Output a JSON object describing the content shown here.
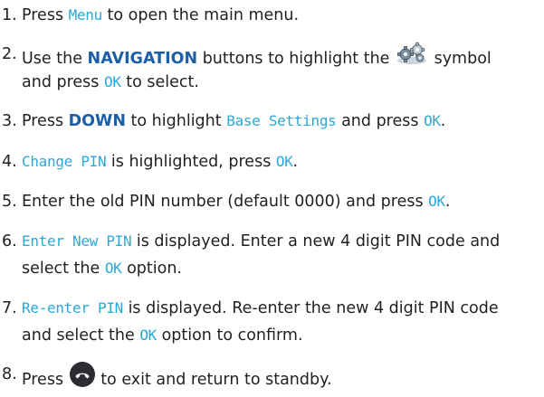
{
  "steps": [
    {
      "number": "1.",
      "lines": [
        [
          {
            "t": "Press "
          },
          {
            "t": "Menu",
            "s": "lcd"
          },
          {
            "t": " to open the main menu."
          }
        ]
      ]
    },
    {
      "number": "2.",
      "lines": [
        [
          {
            "t": "Use the "
          },
          {
            "t": "NAVIGATION",
            "s": "kw"
          },
          {
            "t": " buttons to highlight the "
          },
          {
            "icon": "settings-gear-icon"
          },
          {
            "t": " symbol"
          }
        ],
        [
          {
            "t": "and press "
          },
          {
            "t": "OK",
            "s": "lcd"
          },
          {
            "t": " to select."
          }
        ]
      ]
    },
    {
      "number": "3.",
      "lines": [
        [
          {
            "t": "Press "
          },
          {
            "t": "DOWN",
            "s": "kw"
          },
          {
            "t": " to highlight "
          },
          {
            "t": "Base Settings",
            "s": "lcd"
          },
          {
            "t": " and press "
          },
          {
            "t": "OK",
            "s": "lcd"
          },
          {
            "t": "."
          }
        ]
      ]
    },
    {
      "number": "4.",
      "lines": [
        [
          {
            "t": "Change PIN",
            "s": "lcd"
          },
          {
            "t": " is highlighted, press "
          },
          {
            "t": "OK",
            "s": "lcd"
          },
          {
            "t": "."
          }
        ]
      ]
    },
    {
      "number": "5.",
      "lines": [
        [
          {
            "t": "Enter the old PIN number (default 0000) and press "
          },
          {
            "t": "OK",
            "s": "lcd"
          },
          {
            "t": "."
          }
        ]
      ]
    },
    {
      "number": "6.",
      "lines": [
        [
          {
            "t": "Enter New PIN",
            "s": "lcd"
          },
          {
            "t": " is displayed. Enter a new 4 digit PIN code and"
          }
        ],
        [
          {
            "t": "select the "
          },
          {
            "t": "OK",
            "s": "lcd"
          },
          {
            "t": " option."
          }
        ]
      ]
    },
    {
      "number": "7.",
      "lines": [
        [
          {
            "t": "Re-enter PIN",
            "s": "lcd"
          },
          {
            "t": " is displayed. Re-enter the new 4 digit PIN code"
          }
        ],
        [
          {
            "t": "and select the "
          },
          {
            "t": "OK",
            "s": "lcd"
          },
          {
            "t": " option to confirm."
          }
        ]
      ]
    },
    {
      "number": "8.",
      "lines": [
        [
          {
            "t": "Press "
          },
          {
            "icon": "end-call-icon"
          },
          {
            "t": " to exit and return to standby."
          }
        ]
      ]
    }
  ]
}
